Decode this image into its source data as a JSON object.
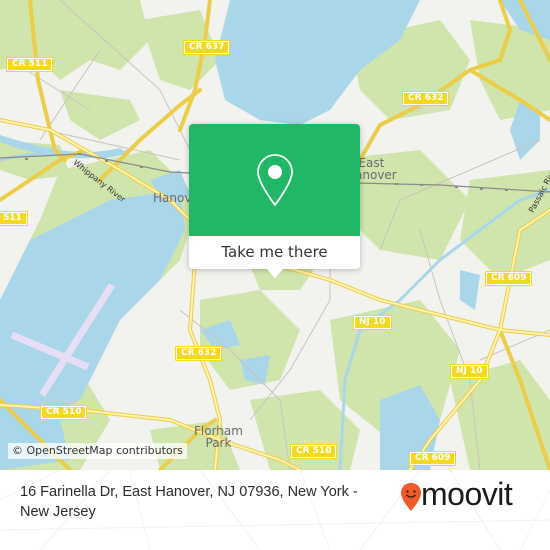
{
  "map": {
    "colors": {
      "land": "#f2f2ee",
      "water": "#aad6ea",
      "green": "#cfe5ab",
      "road_major": "#f3d95c",
      "road_minor": "#c8c4c0",
      "rail": "#8a8a8a",
      "runway": "#e6def5"
    },
    "road_shields": [
      {
        "id": "cr637",
        "label": "CR 637"
      },
      {
        "id": "cr511-top",
        "label": "CR 511"
      },
      {
        "id": "cr511-left",
        "label": "511"
      },
      {
        "id": "cr632-top",
        "label": "CR 632"
      },
      {
        "id": "cr632-mid",
        "label": "CR 632"
      },
      {
        "id": "cr609-right",
        "label": "CR 609"
      },
      {
        "id": "cr609-bottom",
        "label": "CR 609"
      },
      {
        "id": "nj10-a",
        "label": "NJ 10"
      },
      {
        "id": "nj10-b",
        "label": "NJ 10"
      },
      {
        "id": "cr510-left",
        "label": "CR 510"
      },
      {
        "id": "cr510-bottom",
        "label": "CR 510"
      }
    ],
    "places": {
      "hanover": "Hanover",
      "east_hanover_line1": "East",
      "east_hanover_line2": "Hanover",
      "florham_line1": "Florham",
      "florham_line2": "Park"
    },
    "rivers": {
      "whippany": "Whippany River",
      "passaic": "Passaic River"
    },
    "attribution": "© OpenStreetMap contributors"
  },
  "popup": {
    "icon": "map-pin-icon",
    "button_label": "Take me there",
    "color": "#20b866"
  },
  "footer": {
    "address": "16 Farinella Dr, East Hanover, NJ 07936, New York - New Jersey",
    "logo_text": "moovit",
    "logo_icon": "moovit-pin-smile-icon",
    "logo_color": "#f0592a"
  }
}
